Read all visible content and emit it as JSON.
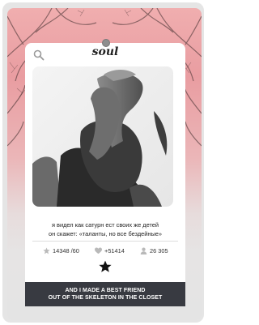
{
  "app": {
    "logo_text": "soul"
  },
  "icons": {
    "search": "search-icon",
    "rating": "star-icon",
    "likes": "heart-icon",
    "views": "person-icon",
    "favorite": "star-filled-icon"
  },
  "post": {
    "caption_line1": "я видел как сатурн ест своих же детей",
    "caption_line2": "он скажет: «таланты, но все бездейные»",
    "stats": {
      "rating": "14348 /60",
      "likes": "+51414",
      "views": "26 305"
    },
    "banner_line1": "AND I MADE A BEST FRIEND",
    "banner_line2": "OUT OF THE SKELETON IN THE CLOSET"
  },
  "colors": {
    "banner_bg": "#383a41",
    "background_top": "#f0aeaf",
    "icon_gray": "#b9b9b9"
  }
}
